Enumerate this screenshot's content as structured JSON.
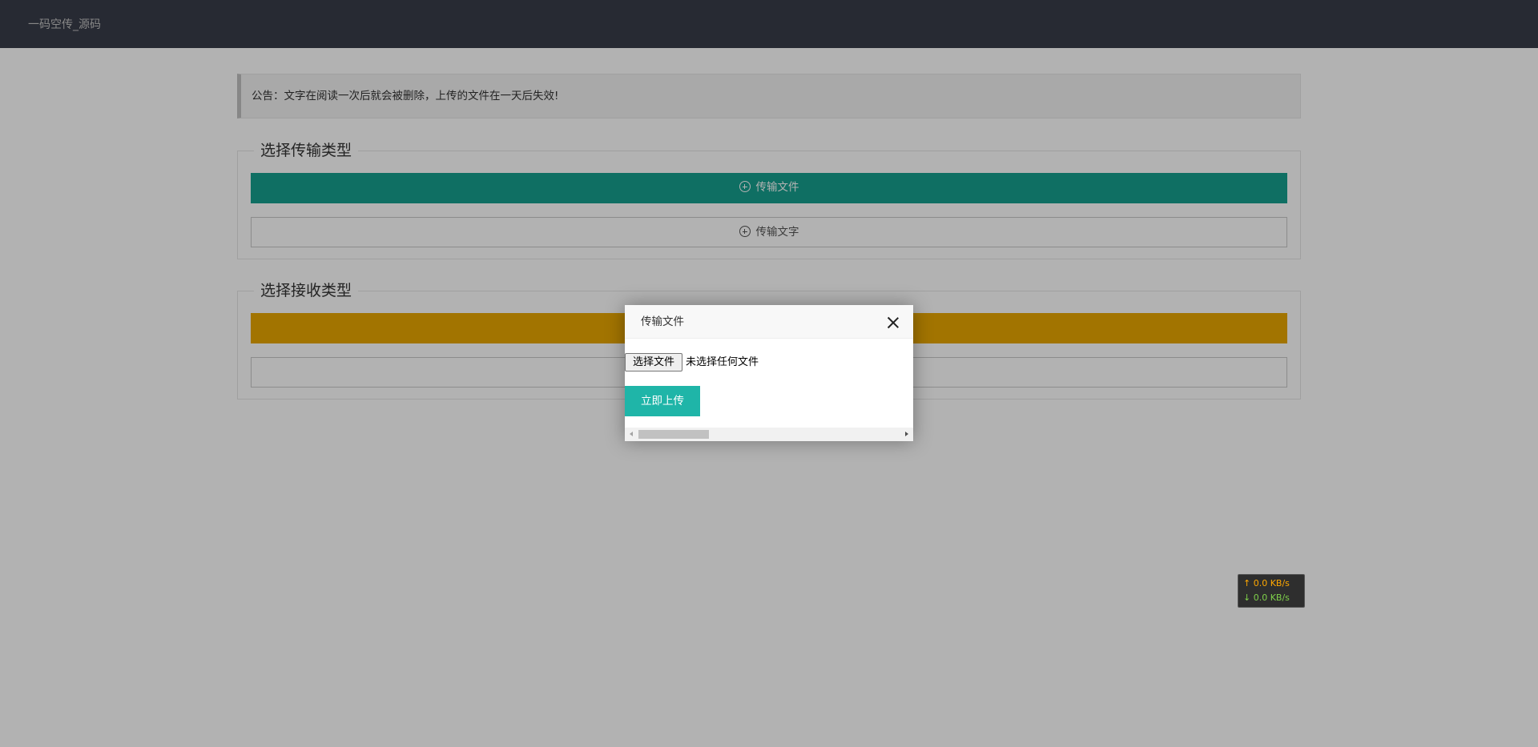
{
  "header": {
    "site_title": "一码空传_源码"
  },
  "notice": {
    "text": "公告：文字在阅读一次后就会被删除，上传的文件在一天后失效!"
  },
  "transfer_section": {
    "legend": "选择传输类型",
    "file_button": "传输文件",
    "text_button": "传输文字"
  },
  "receive_section": {
    "legend": "选择接收类型"
  },
  "dialog": {
    "title": "传输文件",
    "choose_file_label": "选择文件",
    "file_status": "未选择任何文件",
    "upload_button": "立即上传"
  },
  "netspeed": {
    "up": "↑ 0.0 KB/s",
    "down": "↓ 0.0 KB/s"
  },
  "colors": {
    "header_bg": "#393D49",
    "green_button": "#169f8f",
    "yellow_button": "#e8a600",
    "upload_button": "#1fb5a8"
  }
}
